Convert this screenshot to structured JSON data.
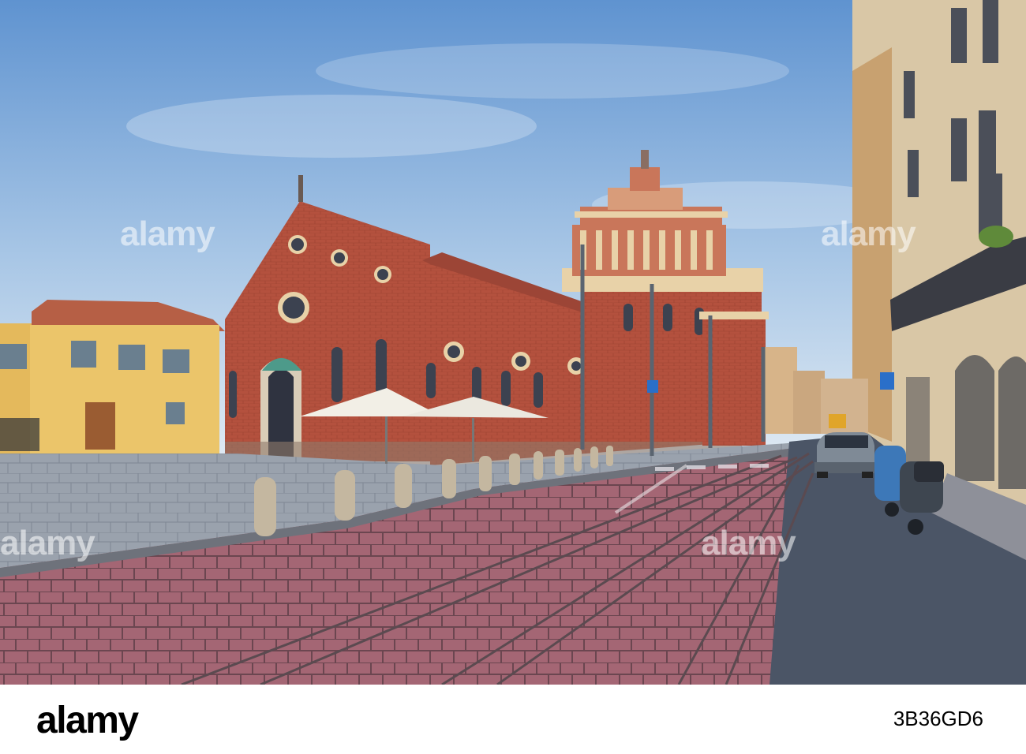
{
  "watermark": {
    "text": "alamy"
  },
  "footer": {
    "logo": "alamy",
    "image_id": "3B36GD6"
  },
  "colors": {
    "sky_top": "#6f9fd6",
    "sky_bottom": "#d7e6f3",
    "brick": "#b5523f",
    "yellow_building": "#e9c46a",
    "cobblestone": "#a8707a",
    "street": "#4a5566"
  }
}
